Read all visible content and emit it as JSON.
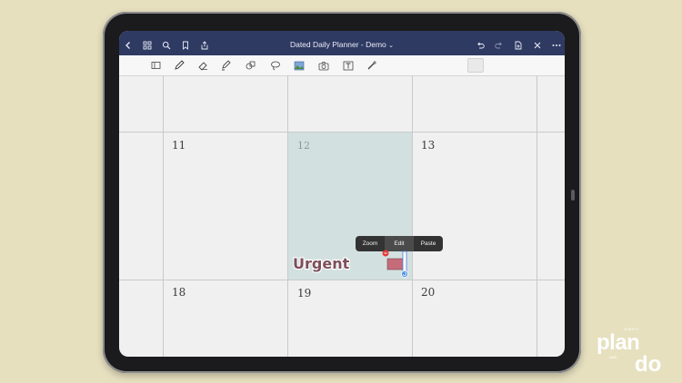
{
  "nav": {
    "title": "Dated Daily Planner - Demo",
    "title_chevron": "⌄"
  },
  "calendar": {
    "days": [
      "11",
      "12",
      "13",
      "18",
      "19",
      "20"
    ]
  },
  "context_menu": {
    "zoom": "Zoom",
    "edit": "Edit",
    "paste": "Paste"
  },
  "sticker": {
    "text": "Urgent"
  },
  "brand": {
    "top": "SIMPLY",
    "plan": "plan",
    "and": "AND",
    "do": "do"
  },
  "colors": {
    "nav_bar": "#2f3a63",
    "selected_cell": "#d3e0e0",
    "page_bg": "#f1f0f0",
    "backdrop": "#e6e0bf",
    "sticker_fill": "#7d4f5a"
  },
  "icons": {
    "nav_left": [
      "back-chevron-icon",
      "grid-icon",
      "search-icon",
      "bookmark-icon",
      "share-icon"
    ],
    "nav_right": [
      "undo-icon",
      "redo-icon",
      "add-page-icon",
      "close-icon",
      "more-icon"
    ],
    "tools": [
      "sidebar-icon",
      "pen-icon",
      "eraser-icon",
      "highlighter-icon",
      "shapes-icon",
      "lasso-icon",
      "image-icon",
      "camera-icon",
      "text-icon",
      "laser-icon"
    ]
  }
}
